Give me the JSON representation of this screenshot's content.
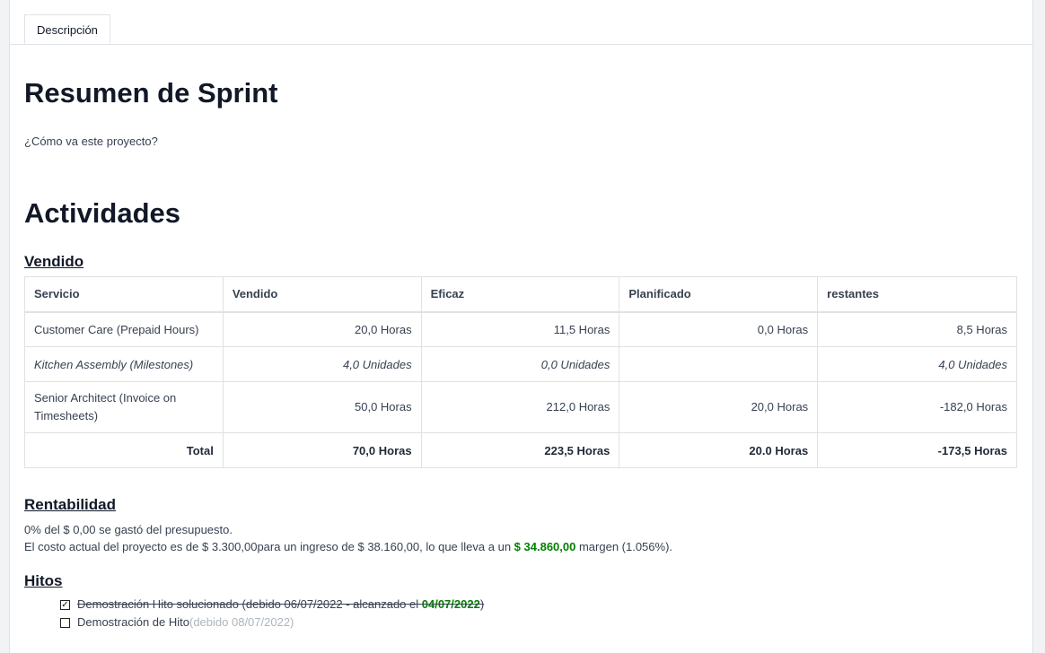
{
  "tabs": [
    {
      "label": "Descripción"
    }
  ],
  "summary": {
    "title": "Resumen de Sprint",
    "question": "¿Cómo va este proyecto?"
  },
  "activities": {
    "title": "Actividades",
    "sold_title": "Vendido",
    "table": {
      "headers": [
        "Servicio",
        "Vendido",
        "Eficaz",
        "Planificado",
        "restantes"
      ],
      "rows": [
        [
          "Customer Care (Prepaid Hours)",
          "20,0 Horas",
          "11,5 Horas",
          "0,0 Horas",
          "8,5 Horas"
        ],
        [
          "Kitchen Assembly (Milestones)",
          "4,0 Unidades",
          "0,0 Unidades",
          "",
          "4,0 Unidades"
        ],
        [
          "Senior Architect (Invoice on Timesheets)",
          "50,0 Horas",
          "212,0 Horas",
          "20,0 Horas",
          "-182,0 Horas"
        ]
      ],
      "total": [
        "Total",
        "70,0 Horas",
        "223,5 Horas",
        "20.0 Horas",
        "-173,5 Horas"
      ]
    }
  },
  "profitability": {
    "title": "Rentabilidad",
    "line1": "0% del $ 0,00 se gastó del presupuesto.",
    "line2_a": "El costo actual del proyecto es de $ 3.300,00para un ingreso de $ 38.160,00, lo que lleva a un ",
    "margin_value": "$ 34.860,00",
    "line2_b": " margen (1.056%).",
    "accent_color": "#008000"
  },
  "milestones": {
    "title": "Hitos",
    "items": [
      {
        "checked": true,
        "text": "Demostración Hito solucionado (debido 06/07/2022 - alcanzado el ",
        "reached_date": "04/07/2022",
        "close": ")"
      },
      {
        "checked": false,
        "text": "Demostración de Hito",
        "due": " (debido 08/07/2022)"
      }
    ]
  }
}
